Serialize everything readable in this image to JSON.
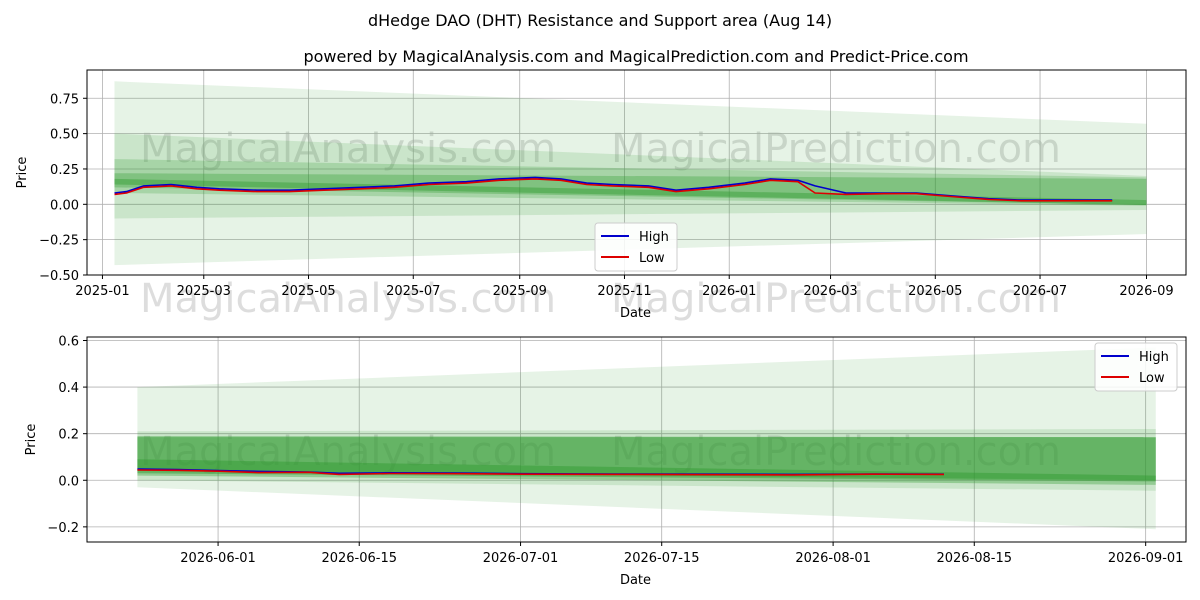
{
  "title": "dHedge DAO (DHT) Resistance and Support area (Aug 14)",
  "subtitle": "powered by MagicalAnalysis.com and MagicalPrediction.com and Predict-Price.com",
  "watermarks": [
    "MagicalAnalysis.com",
    "MagicalPrediction.com"
  ],
  "colors": {
    "high": "#0000cc",
    "low": "#dd0000",
    "band": "#2e9a2e"
  },
  "chart_data": [
    {
      "type": "line",
      "xlabel": "Date",
      "ylabel": "Price",
      "xlim": [
        "2024-12-23",
        "2026-09-24"
      ],
      "ylim": [
        -0.5,
        0.95
      ],
      "xticks": [
        "2025-01-01",
        "2025-03-01",
        "2025-05-01",
        "2025-07-01",
        "2025-09-01",
        "2025-11-01",
        "2026-01-01",
        "2026-03-01",
        "2026-05-01",
        "2026-07-01",
        "2026-09-01"
      ],
      "xtick_labels": [
        "2025-01",
        "2025-03",
        "2025-05",
        "2025-07",
        "2025-09",
        "2025-11",
        "2026-01",
        "2026-03",
        "2026-05",
        "2026-07",
        "2026-09"
      ],
      "yticks": [
        -0.5,
        -0.25,
        0.0,
        0.25,
        0.5,
        0.75
      ],
      "ytick_labels": [
        "−0.50",
        "−0.25",
        "0.00",
        "0.25",
        "0.50",
        "0.75"
      ],
      "grid": true,
      "legend": "lower center",
      "bands": [
        {
          "start": "2025-01-08",
          "end": "2026-09-01",
          "top": [
            0.87,
            0.57
          ],
          "bottom": [
            -0.43,
            -0.21
          ],
          "opacity": 0.12
        },
        {
          "start": "2025-01-08",
          "end": "2026-09-01",
          "top": [
            0.5,
            0.2
          ],
          "bottom": [
            -0.1,
            -0.04
          ],
          "opacity": 0.15
        },
        {
          "start": "2025-01-08",
          "end": "2026-09-01",
          "top": [
            0.32,
            0.19
          ],
          "bottom": [
            0.08,
            -0.01
          ],
          "opacity": 0.22
        },
        {
          "start": "2025-01-08",
          "end": "2026-09-01",
          "top": [
            0.22,
            0.18
          ],
          "bottom": [
            0.12,
            -0.005
          ],
          "opacity": 0.32
        },
        {
          "start": "2025-01-08",
          "end": "2026-09-01",
          "top": [
            0.18,
            0.03
          ],
          "bottom": [
            0.14,
            -0.005
          ],
          "opacity": 0.42
        }
      ],
      "series": [
        {
          "name": "High",
          "x": [
            "2025-01-08",
            "2025-01-15",
            "2025-01-25",
            "2025-02-10",
            "2025-02-25",
            "2025-03-10",
            "2025-04-01",
            "2025-04-20",
            "2025-05-10",
            "2025-06-01",
            "2025-06-20",
            "2025-07-10",
            "2025-08-01",
            "2025-08-20",
            "2025-09-10",
            "2025-09-25",
            "2025-10-10",
            "2025-10-25",
            "2025-11-15",
            "2025-12-01",
            "2025-12-20",
            "2026-01-10",
            "2026-01-25",
            "2026-02-10",
            "2026-02-20",
            "2026-03-10",
            "2026-04-01",
            "2026-04-20",
            "2026-05-10",
            "2026-06-01",
            "2026-06-20",
            "2026-07-10",
            "2026-07-25",
            "2026-08-12"
          ],
          "y": [
            0.08,
            0.09,
            0.13,
            0.14,
            0.12,
            0.11,
            0.1,
            0.1,
            0.11,
            0.12,
            0.13,
            0.15,
            0.16,
            0.18,
            0.19,
            0.18,
            0.15,
            0.14,
            0.13,
            0.1,
            0.12,
            0.15,
            0.18,
            0.17,
            0.13,
            0.08,
            0.08,
            0.08,
            0.06,
            0.04,
            0.03,
            0.03,
            0.03,
            0.03
          ]
        },
        {
          "name": "Low",
          "x": [
            "2025-01-08",
            "2025-01-15",
            "2025-01-25",
            "2025-02-10",
            "2025-02-25",
            "2025-03-10",
            "2025-04-01",
            "2025-04-20",
            "2025-05-10",
            "2025-06-01",
            "2025-06-20",
            "2025-07-10",
            "2025-08-01",
            "2025-08-20",
            "2025-09-10",
            "2025-09-25",
            "2025-10-10",
            "2025-10-25",
            "2025-11-15",
            "2025-12-01",
            "2025-12-20",
            "2026-01-10",
            "2026-01-25",
            "2026-02-10",
            "2026-02-20",
            "2026-03-10",
            "2026-04-01",
            "2026-04-20",
            "2026-05-10",
            "2026-06-01",
            "2026-06-20",
            "2026-07-10",
            "2026-07-25",
            "2026-08-12"
          ],
          "y": [
            0.07,
            0.08,
            0.12,
            0.13,
            0.11,
            0.1,
            0.09,
            0.09,
            0.1,
            0.11,
            0.12,
            0.14,
            0.15,
            0.17,
            0.18,
            0.17,
            0.14,
            0.13,
            0.12,
            0.09,
            0.11,
            0.14,
            0.17,
            0.16,
            0.08,
            0.07,
            0.075,
            0.075,
            0.055,
            0.035,
            0.025,
            0.025,
            0.025,
            0.025
          ]
        }
      ]
    },
    {
      "type": "line",
      "xlabel": "Date",
      "ylabel": "Price",
      "xlim": [
        "2026-05-19",
        "2026-09-05"
      ],
      "ylim": [
        -0.265,
        0.615
      ],
      "xticks": [
        "2026-06-01",
        "2026-06-15",
        "2026-07-01",
        "2026-07-15",
        "2026-08-01",
        "2026-08-15",
        "2026-09-01"
      ],
      "xtick_labels": [
        "2026-06-01",
        "2026-06-15",
        "2026-07-01",
        "2026-07-15",
        "2026-08-01",
        "2026-08-15",
        "2026-09-01"
      ],
      "yticks": [
        -0.2,
        0.0,
        0.2,
        0.4,
        0.6
      ],
      "ytick_labels": [
        "−0.2",
        "0.0",
        "0.2",
        "0.4",
        "0.6"
      ],
      "grid": true,
      "legend": "upper right",
      "bands": [
        {
          "start": "2026-05-24",
          "end": "2026-09-02",
          "top": [
            0.4,
            0.57
          ],
          "bottom": [
            -0.03,
            -0.21
          ],
          "opacity": 0.12
        },
        {
          "start": "2026-05-24",
          "end": "2026-09-02",
          "top": [
            0.21,
            0.22
          ],
          "bottom": [
            0.0,
            -0.045
          ],
          "opacity": 0.15
        },
        {
          "start": "2026-05-24",
          "end": "2026-09-02",
          "top": [
            0.19,
            0.185
          ],
          "bottom": [
            0.02,
            -0.02
          ],
          "opacity": 0.35
        },
        {
          "start": "2026-05-24",
          "end": "2026-09-02",
          "top": [
            0.185,
            0.185
          ],
          "bottom": [
            0.03,
            -0.005
          ],
          "opacity": 0.45
        },
        {
          "start": "2026-05-24",
          "end": "2026-09-02",
          "top": [
            0.09,
            0.02
          ],
          "bottom": [
            0.04,
            0.0
          ],
          "opacity": 0.45
        }
      ],
      "series": [
        {
          "name": "High",
          "x": [
            "2026-05-24",
            "2026-05-28",
            "2026-06-01",
            "2026-06-05",
            "2026-06-10",
            "2026-06-13",
            "2026-06-18",
            "2026-06-25",
            "2026-07-01",
            "2026-07-10",
            "2026-07-20",
            "2026-07-28",
            "2026-08-05",
            "2026-08-12"
          ],
          "y": [
            0.048,
            0.046,
            0.042,
            0.038,
            0.035,
            0.03,
            0.032,
            0.031,
            0.028,
            0.027,
            0.026,
            0.025,
            0.027,
            0.026
          ]
        },
        {
          "name": "Low",
          "x": [
            "2026-05-24",
            "2026-05-28",
            "2026-06-01",
            "2026-06-05",
            "2026-06-10",
            "2026-06-13",
            "2026-06-18",
            "2026-06-25",
            "2026-07-01",
            "2026-07-10",
            "2026-07-20",
            "2026-07-28",
            "2026-08-05",
            "2026-08-12"
          ],
          "y": [
            0.044,
            0.043,
            0.039,
            0.033,
            0.034,
            0.025,
            0.029,
            0.028,
            0.026,
            0.025,
            0.024,
            0.023,
            0.026,
            0.025
          ]
        }
      ]
    }
  ]
}
